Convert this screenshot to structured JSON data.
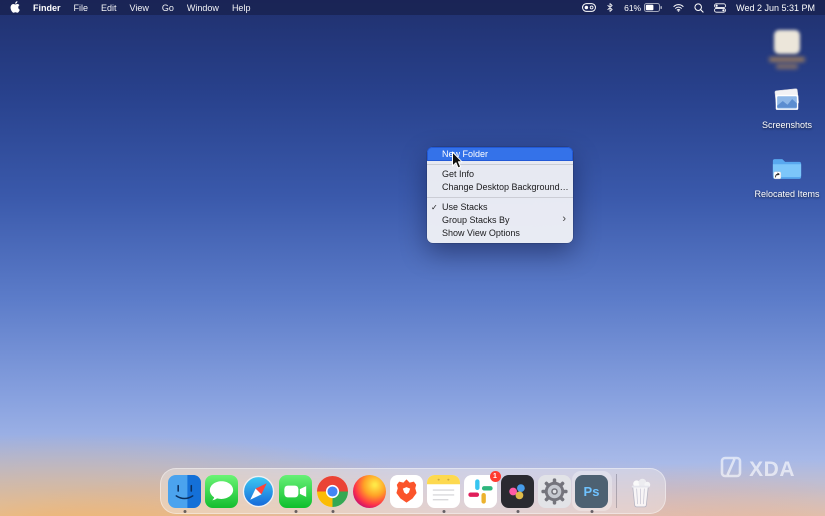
{
  "menu_bar": {
    "app_name": "Finder",
    "menus": [
      "File",
      "Edit",
      "View",
      "Go",
      "Window",
      "Help"
    ],
    "status": {
      "battery_percent": "61%",
      "clock": "Wed 2 Jun 5:31 PM"
    },
    "status_icons": [
      "toggle-pill",
      "bluetooth",
      "battery",
      "wifi",
      "spotlight-search",
      "control-center"
    ]
  },
  "desktop_icons": [
    {
      "label": "",
      "type": "blurred-app"
    },
    {
      "label": "Screenshots",
      "type": "image-stack"
    },
    {
      "label": "Relocated Items",
      "type": "alias-folder"
    }
  ],
  "context_menu": {
    "check_glyph": "✓",
    "chevron_glyph": "›",
    "items": [
      {
        "label": "New Folder",
        "highlighted": true
      },
      {
        "label": "Get Info"
      },
      {
        "label": "Change Desktop Background…"
      },
      {
        "label": "Use Stacks",
        "checked": true
      },
      {
        "label": "Group Stacks By",
        "has_submenu": true
      },
      {
        "label": "Show View Options"
      }
    ]
  },
  "dock": {
    "apps": [
      {
        "name": "Finder",
        "running": true
      },
      {
        "name": "Messages",
        "running": false
      },
      {
        "name": "Safari",
        "running": false
      },
      {
        "name": "FaceTime",
        "running": true
      },
      {
        "name": "Google Chrome",
        "running": true
      },
      {
        "name": "Firefox",
        "running": false
      },
      {
        "name": "Brave",
        "running": false
      },
      {
        "name": "Notes",
        "running": true
      },
      {
        "name": "Slack",
        "running": false,
        "badge": "1"
      },
      {
        "name": "Dark photo app",
        "running": true
      },
      {
        "name": "System Preferences",
        "running": false
      },
      {
        "name": "Photoshop",
        "running": true
      },
      {
        "name": "Trash",
        "running": false
      }
    ],
    "slack_badge": "1",
    "photoshop_label": "Ps"
  },
  "watermark": {
    "text": "XDA"
  }
}
